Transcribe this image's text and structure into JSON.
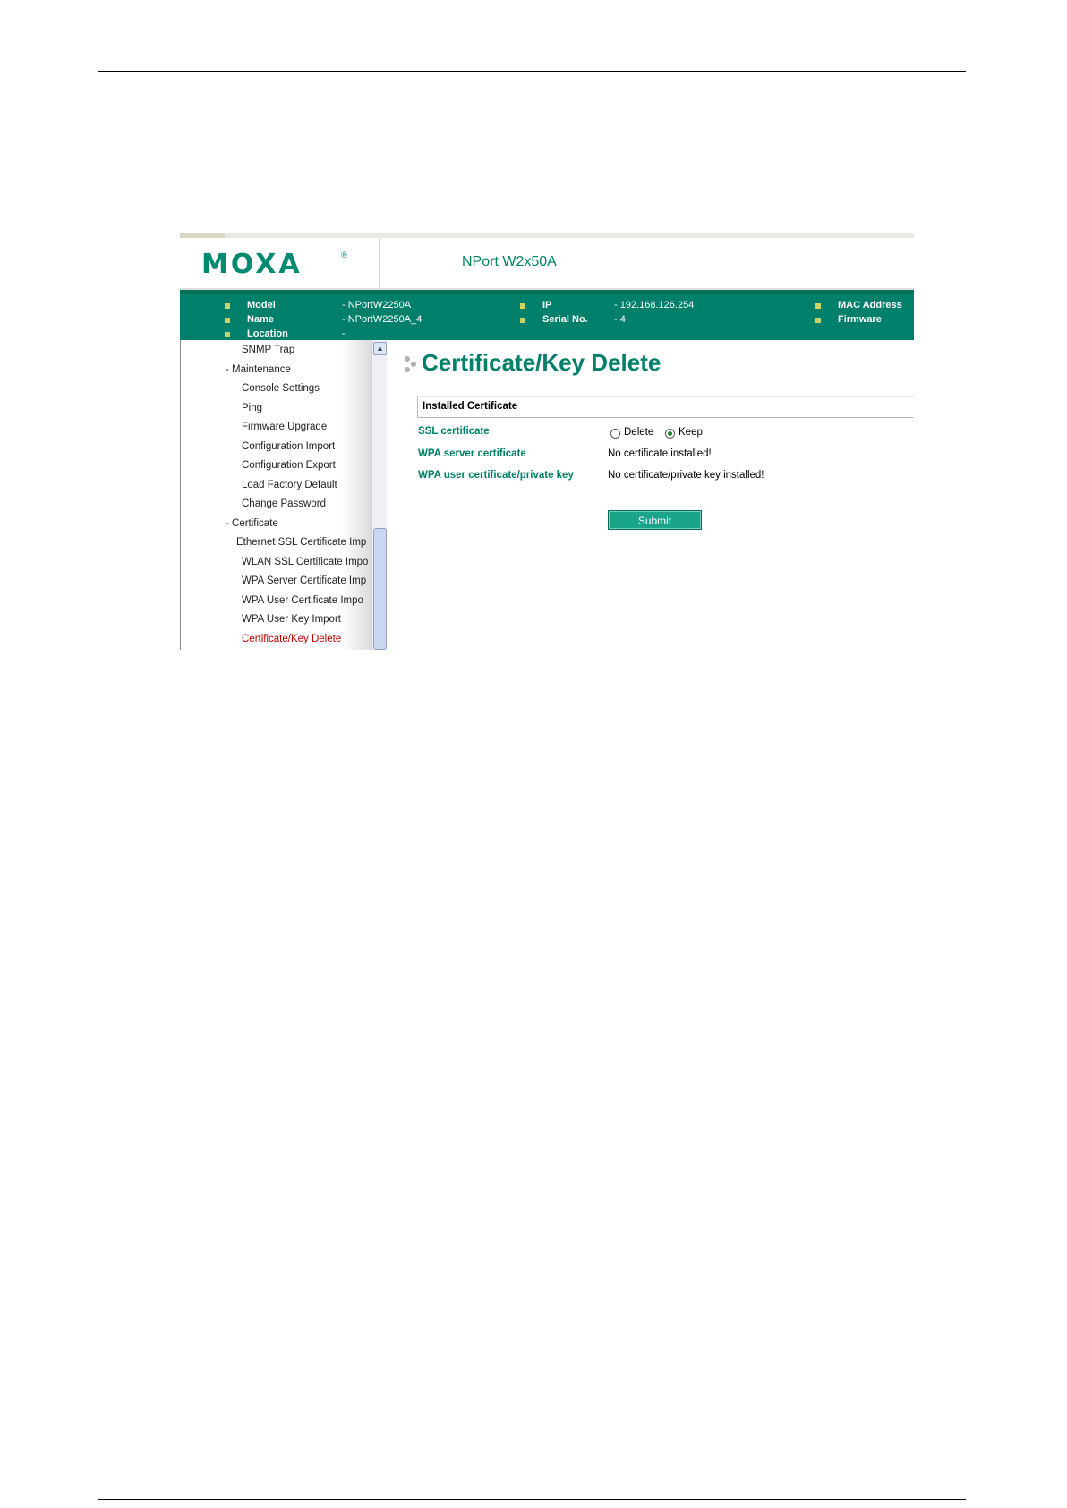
{
  "brand": {
    "logo": "MOXA",
    "registered": "®",
    "product": "NPort W2x50A"
  },
  "info": {
    "col1": [
      {
        "label": "Model",
        "value": "- NPortW2250A"
      },
      {
        "label": "Name",
        "value": "- NPortW2250A_4"
      },
      {
        "label": "Location",
        "value": "-"
      }
    ],
    "col2": [
      {
        "label": "IP",
        "value": "- 192.168.126.254"
      },
      {
        "label": "Serial No.",
        "value": "- 4"
      }
    ],
    "col3": [
      {
        "label": "MAC Address"
      },
      {
        "label": "Firmware"
      }
    ]
  },
  "sidebar": {
    "items": [
      "SNMP Trap",
      "- Maintenance",
      "Console Settings",
      "Ping",
      "Firmware Upgrade",
      "Configuration Import",
      "Configuration Export",
      "Load Factory Default",
      "Change Password",
      "- Certificate",
      "Ethernet SSL Certificate Imp",
      "WLAN SSL Certificate Impo",
      "WPA Server Certificate Imp",
      "WPA User Certificate Impo",
      "WPA User Key Import",
      "Certificate/Key Delete"
    ],
    "scroll_up": "▲"
  },
  "main": {
    "title": "Certificate/Key Delete",
    "section": "Installed Certificate",
    "fields": {
      "ssl_label": "SSL certificate",
      "ssl_delete": "Delete",
      "ssl_keep": "Keep",
      "wpa_server_label": "WPA server certificate",
      "wpa_server_value": "No certificate installed!",
      "wpa_user_label": "WPA user certificate/private key",
      "wpa_user_value": "No certificate/private key installed!"
    },
    "submit_label": "Submit"
  },
  "colors": {
    "brand_green": "#00806a",
    "active_menu": "#c00000",
    "button": "#1aa58b"
  }
}
